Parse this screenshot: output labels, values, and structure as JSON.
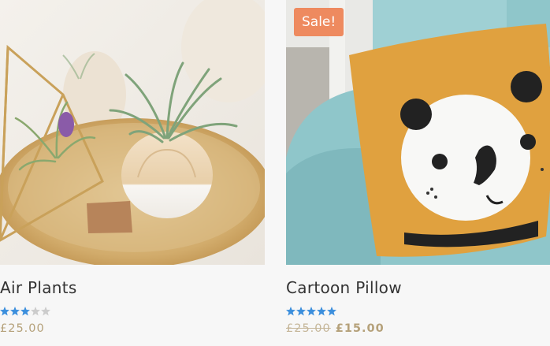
{
  "products": [
    {
      "title": "Air Plants",
      "image_alt": "Air plants in a white pot on a gold tray",
      "rating": 3,
      "rating_max": 5,
      "price": "£25.00",
      "on_sale": false
    },
    {
      "title": "Cartoon Pillow",
      "image_alt": "Yellow cartoon bear pillow on a blue chair",
      "rating": 5,
      "rating_max": 5,
      "sale_badge": "Sale!",
      "old_price": "£25.00",
      "price": "£15.00",
      "on_sale": true
    }
  ],
  "colors": {
    "star_filled": "#3c8fdd",
    "star_empty": "#cccccc",
    "badge": "#ee8a5f",
    "price": "#b5a17a"
  }
}
